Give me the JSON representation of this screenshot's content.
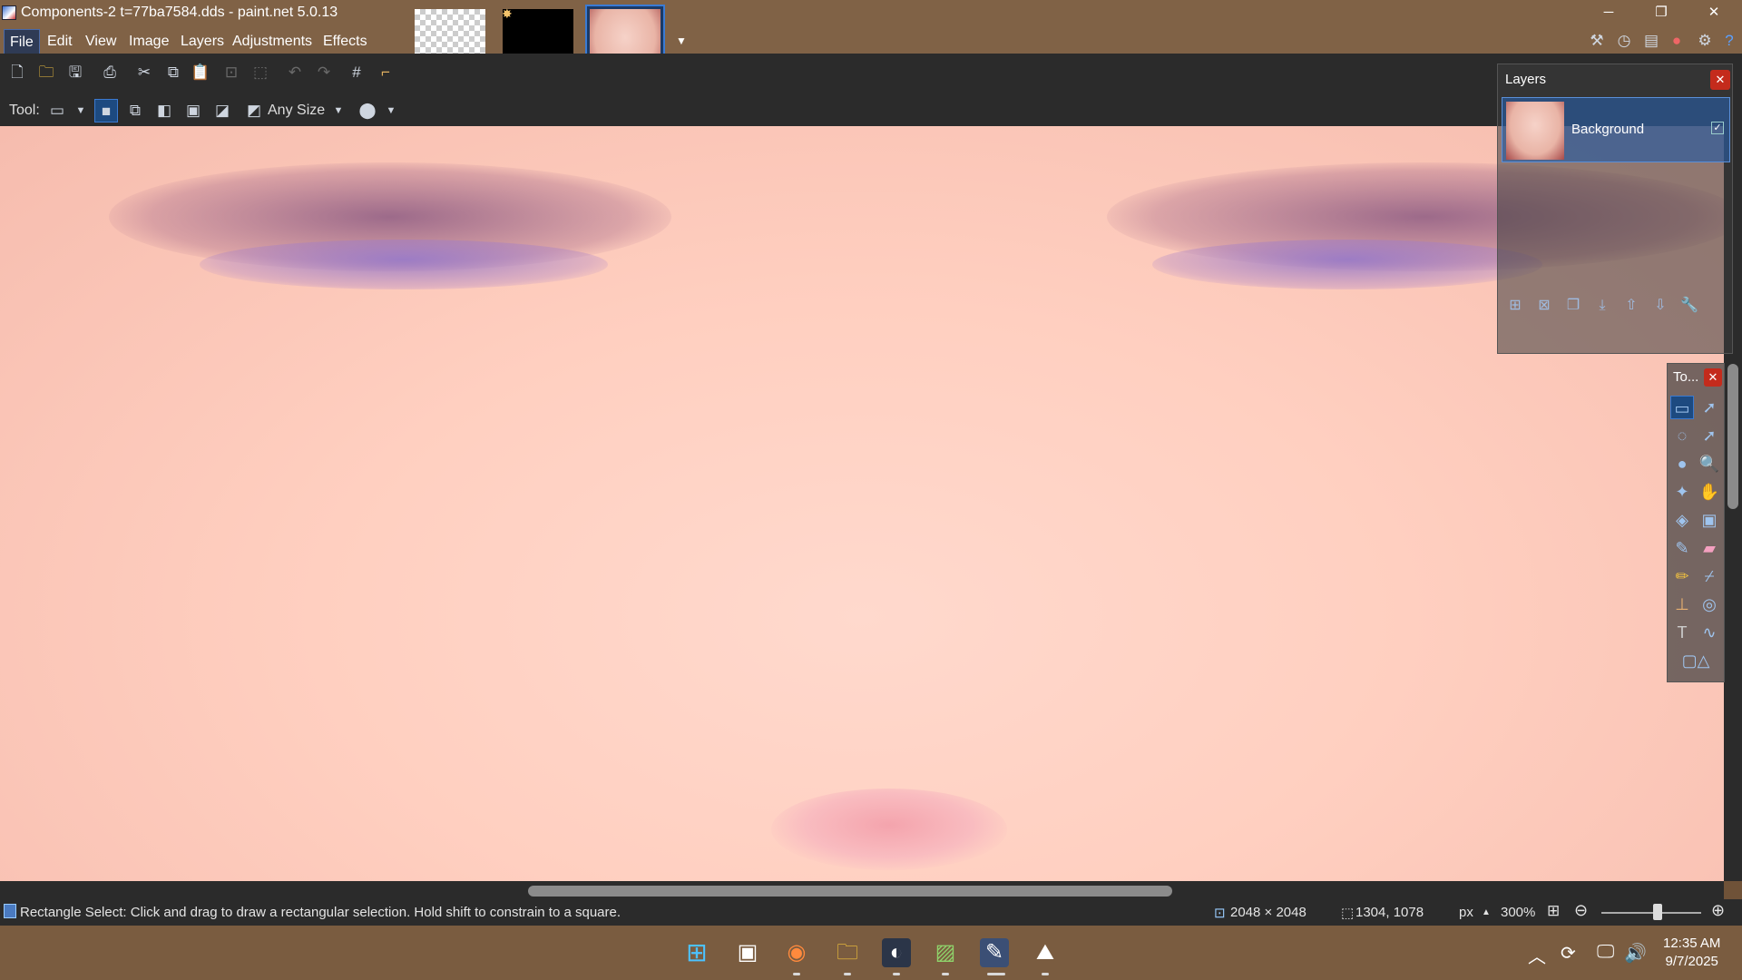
{
  "window": {
    "title": "Components-2 t=77ba7584.dds - paint.net 5.0.13",
    "controls": {
      "minimize": "─",
      "restore": "❐",
      "close": "✕"
    }
  },
  "menu": [
    "File",
    "Edit",
    "View",
    "Image",
    "Layers",
    "Adjustments",
    "Effects"
  ],
  "toolbar": {
    "tool_label": "Tool:",
    "size_mode": "Any Size"
  },
  "status": {
    "hint": "Rectangle Select: Click and drag to draw a rectangular selection. Hold shift to constrain to a square.",
    "image_size": "2048 × 2048",
    "cursor_pos": "1304, 1078",
    "units": "px",
    "zoom": "300%"
  },
  "layers_panel": {
    "title": "Layers",
    "layers": [
      {
        "name": "Background",
        "visible": true
      }
    ]
  },
  "tools_panel": {
    "title": "To..."
  },
  "taskbar": {
    "time": "12:35 AM",
    "date": "9/7/2025"
  },
  "colors": {
    "accent": "#3b7ad0",
    "titlebar": "#806246",
    "chrome": "#2b2b2b"
  }
}
